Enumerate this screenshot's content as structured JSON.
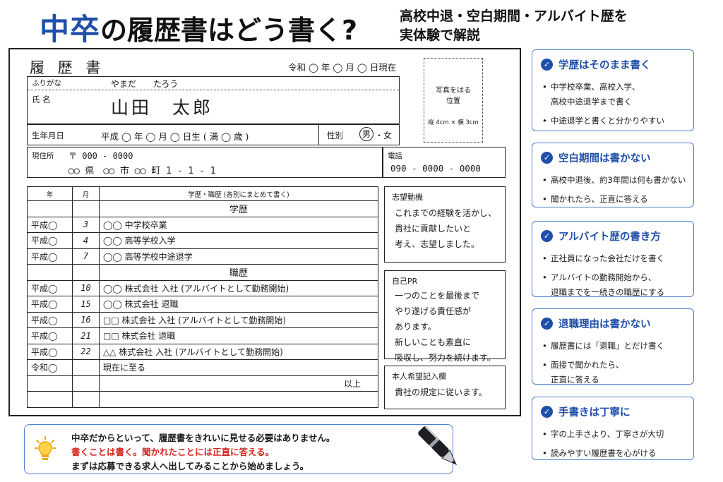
{
  "header": {
    "title_blue": "中卒",
    "title_black": "の履歴書はどう書く?",
    "subtitle_1": "高校中退・空白期間・アルバイト歴を",
    "subtitle_2": "実体験で解説"
  },
  "resume": {
    "title": "履 歴 書",
    "date": "令和 ◯ 年 ◯ 月 ◯ 日現在",
    "furigana_label": "ふりがな",
    "furigana_value": "やまだ　　たろう",
    "name_label": "氏 名",
    "name_value": "山田　太郎",
    "birth_label": "生年月日",
    "birth_value": "平成 ◯ 年 ◯ 月 ◯ 日生 ( 満 ◯ 歳 )",
    "gender_label": "性別",
    "gender_male": "男",
    "gender_sep": "・",
    "gender_female": "女",
    "photo_text_1": "写真をはる",
    "photo_text_2": "位置",
    "photo_size": "縦 4cm × 横 3cm",
    "address_label": "現住所",
    "address_zip": "〒 000 - 0000",
    "address_value": "◯◯ 県　◯◯ 市 ◯◯ 町 1 - 1 - 1",
    "phone_label": "電話",
    "phone_value": "090 - 0000 - 0000",
    "history_header": {
      "year": "年",
      "month": "月",
      "content": "学歴・職歴 (各別にまとめて書く)"
    },
    "education_title": "学歴",
    "education_rows": [
      {
        "year": "平成◯",
        "month": "3",
        "content": "◯◯ 中学校卒業"
      },
      {
        "year": "平成◯",
        "month": "4",
        "content": "◯◯ 高等学校入学"
      },
      {
        "year": "平成◯",
        "month": "7",
        "content": "◯◯ 高等学校中途退学"
      }
    ],
    "work_title": "職歴",
    "work_rows": [
      {
        "year": "平成◯",
        "month": "10",
        "content": "◯◯ 株式会社 入社 (アルバイトとして勤務開始)"
      },
      {
        "year": "平成◯",
        "month": "15",
        "content": "◯◯ 株式会社 退職"
      },
      {
        "year": "平成◯",
        "month": "16",
        "content": "□□ 株式会社 入社 (アルバイトとして勤務開始)"
      },
      {
        "year": "平成◯",
        "month": "21",
        "content": "□□ 株式会社 退職"
      },
      {
        "year": "平成◯",
        "month": "22",
        "content": "△△ 株式会社 入社 (アルバイトとして勤務開始)"
      },
      {
        "year": "令和◯",
        "month": "",
        "content": "現在に至る"
      }
    ],
    "end_text": "以上",
    "motivation_title": "志望動機",
    "motivation_lines": [
      "これまでの経験を活かし、",
      "貴社に貢献したいと",
      "考え、志望しました。"
    ],
    "pr_title": "自己PR",
    "pr_lines": [
      "一つのことを最後まで",
      "やり遂げる責任感が",
      "あります。",
      "新しいことも素直に",
      "吸収し、努力を続けます。"
    ],
    "request_title": "本人希望記入欄",
    "request_value": "貴社の規定に従います。"
  },
  "cards": [
    {
      "title": "学歴はそのまま書く",
      "items": [
        {
          "text": "中学校卒業、高校入学、",
          "bullet": true
        },
        {
          "text": "高校中途退学まで書く",
          "bullet": false
        },
        {
          "text": "中途退学と書くと分かりやすい",
          "bullet": true
        }
      ]
    },
    {
      "title": "空白期間は書かない",
      "items": [
        {
          "text": "高校中退後、約3年間は何も書かない",
          "bullet": true
        },
        {
          "text": "聞かれたら、正直に答える",
          "bullet": true
        }
      ]
    },
    {
      "title": "アルバイト歴の書き方",
      "items": [
        {
          "text": "正社員になった会社だけを書く",
          "bullet": true
        },
        {
          "text": "アルバイトの勤務開始から、",
          "bullet": true
        },
        {
          "text": "退職までを一続きの職歴にする",
          "bullet": false
        }
      ]
    },
    {
      "title": "退職理由は書かない",
      "items": [
        {
          "text": "履歴書には「退職」とだけ書く",
          "bullet": true
        },
        {
          "text": "面接で聞かれたら、",
          "bullet": true
        },
        {
          "text": "正直に答える",
          "bullet": false
        }
      ]
    },
    {
      "title": "手書きは丁寧に",
      "items": [
        {
          "text": "字の上手さより、丁寧さが大切",
          "bullet": true
        },
        {
          "text": "読みやすい履歴書を心がける",
          "bullet": true
        }
      ]
    }
  ],
  "note": {
    "line1": "中卒だからといって、履歴書をきれいに見せる必要はありません。",
    "line2": "書くことは書く。聞かれたことには正直に答える。",
    "line3": "まずは応募できる求人へ出してみることから始めましょう。"
  },
  "colors": {
    "accent": "#1f4fa8",
    "card_border": "#4f7fcf",
    "alert": "#d4261f"
  },
  "icons": [
    "check-circle-icon",
    "lightbulb-icon",
    "pen-icon"
  ]
}
